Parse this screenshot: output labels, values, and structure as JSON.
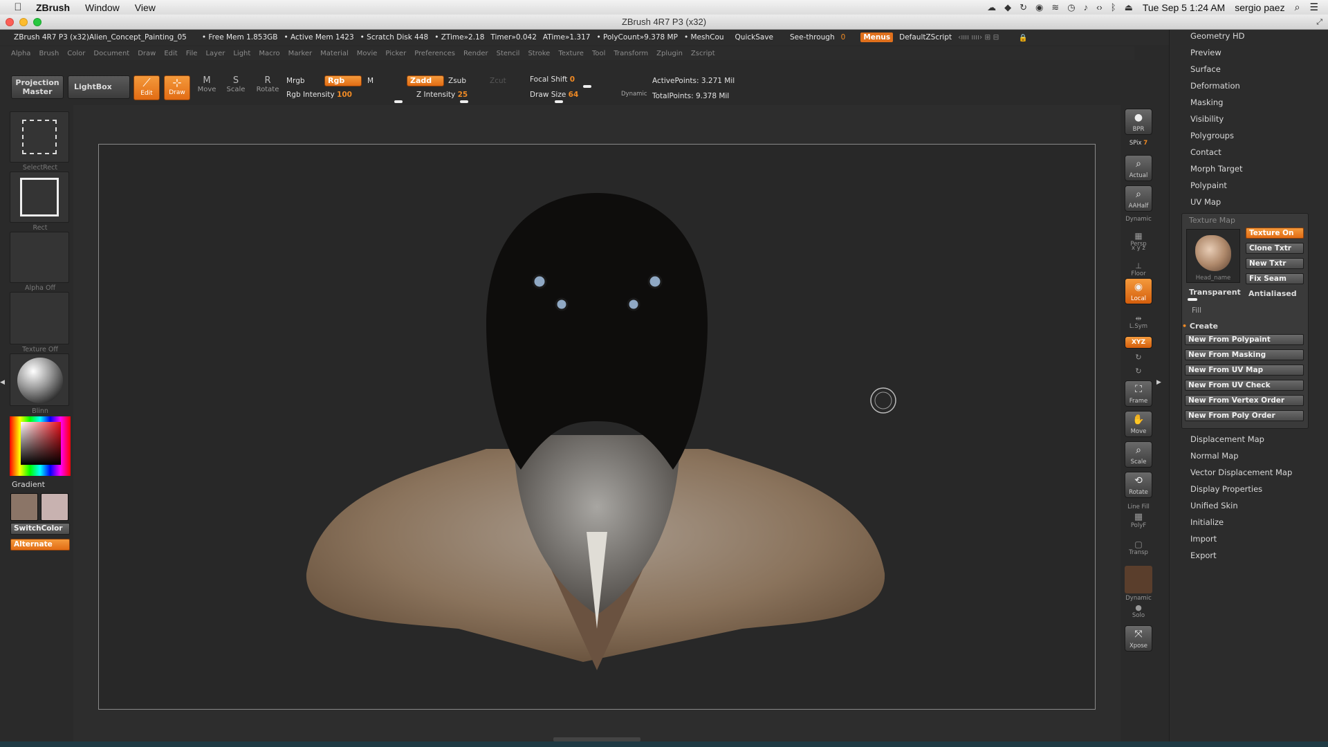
{
  "macmenu": {
    "app": "ZBrush",
    "items": [
      "Window",
      "View"
    ],
    "clock": "Tue Sep 5  1:24 AM",
    "user": "sergio paez"
  },
  "window": {
    "title": "ZBrush 4R7 P3 (x32)"
  },
  "status": {
    "doc": "ZBrush 4R7 P3 (x32)Alien_Concept_Painting_05",
    "free_mem": "• Free Mem 1.853GB",
    "active_mem": "• Active Mem 1423",
    "scratch": "• Scratch Disk 448",
    "ztime": "• ZTime»2.18",
    "timer": "Timer»0.042",
    "atime": "ATime»1.317",
    "polycount": "• PolyCount»9.378 MP",
    "meshcount": "• MeshCou",
    "quicksave": "QuickSave",
    "seethrough_label": "See-through",
    "seethrough_value": "0",
    "menus": "Menus",
    "defaultzscript": "DefaultZScript"
  },
  "menus": [
    "Alpha",
    "Brush",
    "Color",
    "Document",
    "Draw",
    "Edit",
    "File",
    "Layer",
    "Light",
    "Macro",
    "Marker",
    "Material",
    "Movie",
    "Picker",
    "Preferences",
    "Render",
    "Stencil",
    "Stroke",
    "Texture",
    "Tool",
    "Transform",
    "Zplugin",
    "Zscript"
  ],
  "toolbar": {
    "projection_master": "Projection Master",
    "lightbox": "LightBox",
    "edit": "Edit",
    "draw": "Draw",
    "move": "Move",
    "scale": "Scale",
    "rotate": "Rotate",
    "mrgb": "Mrgb",
    "rgb": "Rgb",
    "m": "M",
    "zadd": "Zadd",
    "zsub": "Zsub",
    "zcut": "Zcut",
    "rgb_intensity_label": "Rgb Intensity",
    "rgb_intensity": "100",
    "z_intensity_label": "Z Intensity",
    "z_intensity": "25",
    "focal_shift_label": "Focal Shift",
    "focal_shift": "0",
    "draw_size_label": "Draw Size",
    "draw_size": "64",
    "dynamic": "Dynamic",
    "active_points": "ActivePoints: 3.271  Mil",
    "total_points": "TotalPoints: 9.378  Mil"
  },
  "left": {
    "selectrect": "SelectRect",
    "rect": "Rect",
    "alpha": "Alpha  Off",
    "texture": "Texture  Off",
    "material": "Blinn",
    "gradient": "Gradient",
    "switchcolor": "SwitchColor",
    "alternate": "Alternate",
    "main_color": "#8b7567",
    "secondary_color": "#c8b2b0"
  },
  "right": {
    "bpr": "BPR",
    "spix_label": "SPix",
    "spix": "7",
    "actual": "Actual",
    "aahalf": "AAHalf",
    "dynamic": "Dynamic",
    "persp": "Persp",
    "xyz_small": "x y z",
    "floor": "Floor",
    "local": "Local",
    "lsym": "L.Sym",
    "xyz": "XYZ",
    "frame": "Frame",
    "move": "Move",
    "scale": "Scale",
    "rotate": "Rotate",
    "linefill": "Line Fill",
    "polyf": "PolyF",
    "transp": "Transp",
    "dynamic2": "Dynamic",
    "solo": "Solo",
    "xpose": "Xpose"
  },
  "tray": {
    "top_items": [
      "Geometry HD",
      "Preview",
      "Surface",
      "Deformation",
      "Masking",
      "Visibility",
      "Polygroups",
      "Contact",
      "Morph Target",
      "Polypaint",
      "UV Map"
    ],
    "texture_map": {
      "title": "Texture Map",
      "texture_on": "Texture On",
      "clone_txtr": "Clone Txtr",
      "new_txtr": "New Txtr",
      "fix_seam": "Fix Seam",
      "thumb_caption": "Head_name",
      "transparent": "Transparent",
      "antialiased": "Antialiased",
      "fill": "Fill",
      "create": "Create",
      "create_buttons": [
        "New From Polypaint",
        "New From Masking",
        "New From UV Map",
        "New From UV Check",
        "New From Vertex Order",
        "New From Poly Order"
      ]
    },
    "bottom_items": [
      "Displacement Map",
      "Normal Map",
      "Vector Displacement Map",
      "Display Properties",
      "Unified Skin",
      "Initialize",
      "Import",
      "Export"
    ]
  }
}
